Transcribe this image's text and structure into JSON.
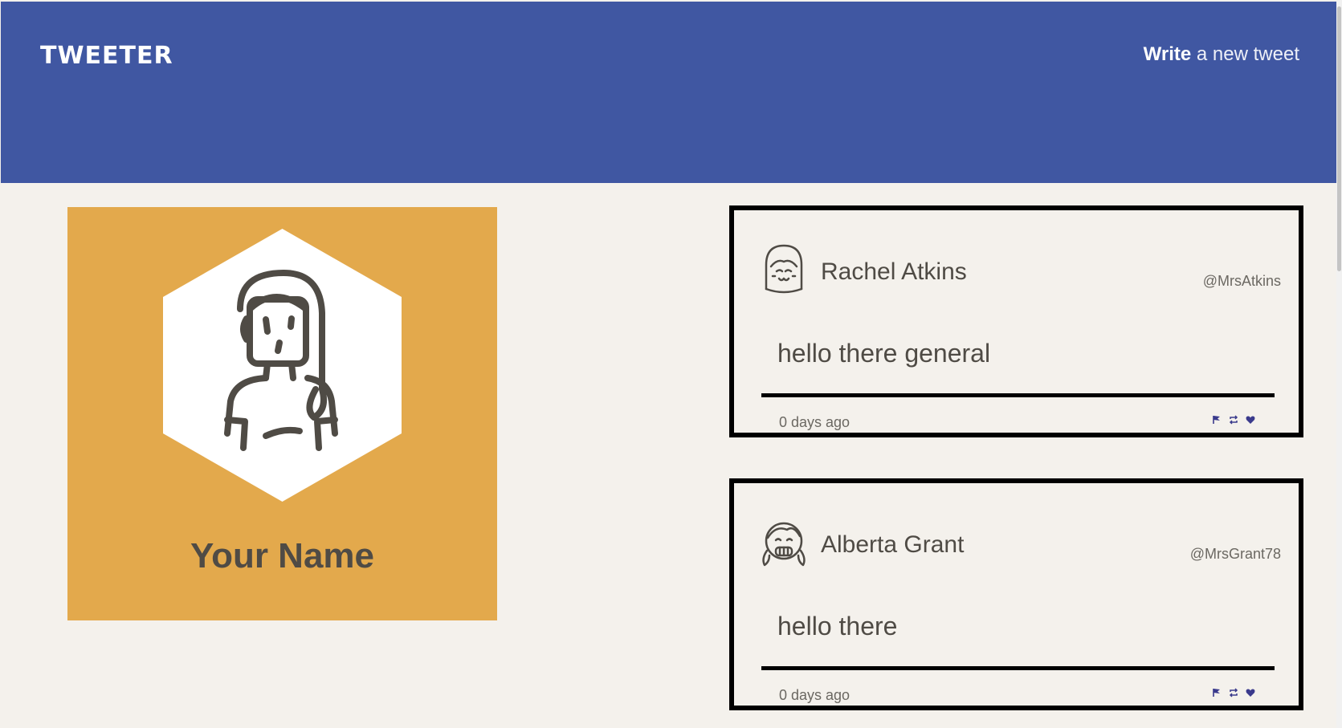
{
  "nav": {
    "brand": "TWEETER",
    "compose_bold": "Write",
    "compose_rest": " a new tweet"
  },
  "profile": {
    "name": "Your Name",
    "card_color": "#e3a94c",
    "avatar_icon": "woman-avatar-icon"
  },
  "tweets": [
    {
      "name": "Rachel Atkins",
      "handle": "@MrsAtkins",
      "content": "hello there general",
      "time": "0 days ago",
      "avatar_icon": "smiling-girl-avatar-icon"
    },
    {
      "name": "Alberta Grant",
      "handle": "@MrsGrant78",
      "content": "hello there",
      "time": "0 days ago",
      "avatar_icon": "grinning-girl-avatar-icon"
    }
  ],
  "actions": [
    "flag-icon",
    "retweet-icon",
    "heart-icon"
  ],
  "colors": {
    "header": "#4057a2",
    "background": "#f4f1ec",
    "accent": "#3a3a8c"
  }
}
